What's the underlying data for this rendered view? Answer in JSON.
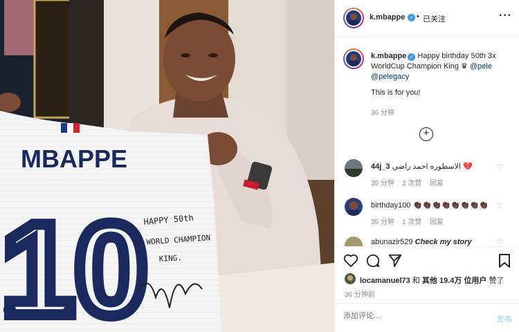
{
  "header": {
    "username": "k.mbappe",
    "dot": "•",
    "follow_status": "已关注",
    "more_icon": "more-horizontal-icon"
  },
  "caption": {
    "username": "k.mbappe",
    "text_part1": "Happy birthday 50th 3x WorldCup Champion King",
    "crown": "♛",
    "mention1": "@pele",
    "mention2": "@pelegacy",
    "line2": "This is for you!",
    "time": "36 分钟"
  },
  "load_more_icon": "plus-circle-icon",
  "comments": [
    {
      "username": "44j_3",
      "text": "الاسطوره احمد راضي",
      "emoji": "💔",
      "time": "35 分钟",
      "likes": "2 次赞",
      "reply": "回复"
    },
    {
      "username": "birthday100",
      "text": "👏🏿👏🏿👏🏿👏🏿👏🏿👏🏿👏🏿👏🏿",
      "emoji": "",
      "time": "35 分钟",
      "likes": "1 次赞",
      "reply": "回复"
    },
    {
      "username": "abunazir529",
      "text": "Check my story",
      "emoji": "",
      "time": "",
      "likes": "",
      "reply": ""
    }
  ],
  "actions": {
    "like_icon": "heart-icon",
    "comment_icon": "comment-icon",
    "share_icon": "send-icon",
    "save_icon": "bookmark-icon"
  },
  "likes_line": {
    "user": "locamanuel73",
    "connector": "和",
    "others": "其他 19.4万 位用户",
    "suffix": "赞了"
  },
  "post_time": "36 分钟前",
  "comment_input": {
    "placeholder": "添加评论...",
    "submit": "发布"
  },
  "jersey": {
    "name": "MBAPPE",
    "number": "10",
    "note_line1": "HAPPY 50th",
    "note_line2": "3x WORLD CHAMPION",
    "note_line3": "KING."
  },
  "colors": {
    "accent_blue": "#0095f6",
    "link": "#00376b",
    "muted": "#8e8e8e"
  }
}
